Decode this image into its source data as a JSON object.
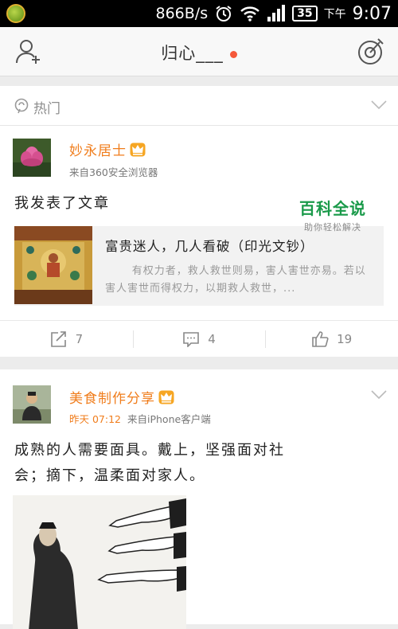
{
  "status_bar": {
    "speed": "866B/s",
    "battery": "35",
    "ampm": "下午",
    "time": "9:07"
  },
  "header": {
    "title": "归心___"
  },
  "hot_section": {
    "label": "热门"
  },
  "posts": [
    {
      "username": "妙永居士",
      "source": "来自360安全浏览器",
      "text": "我发表了文章",
      "article": {
        "title": "富贵迷人，几人看破（印光文钞）",
        "summary": "有权力者，救人救世则易，害人害世亦易。若以害人害世而得权力，以期救人救世，..."
      },
      "actions": {
        "share_count": "7",
        "comment_count": "4",
        "like_count": "19"
      }
    },
    {
      "username": "美食制作分享",
      "time": "昨天 07:12",
      "source": "来自iPhone客户端",
      "text_line1": "成熟的人需要面具。戴上，坚强面对社",
      "text_line2": "会；摘下，温柔面对家人。"
    }
  ],
  "watermark": {
    "title": "百科全说",
    "subtitle": "助你轻松解决"
  },
  "colors": {
    "accent_orange": "#f07d1c",
    "notification_dot": "#f5583a",
    "watermark_green": "#1a9a4a"
  }
}
